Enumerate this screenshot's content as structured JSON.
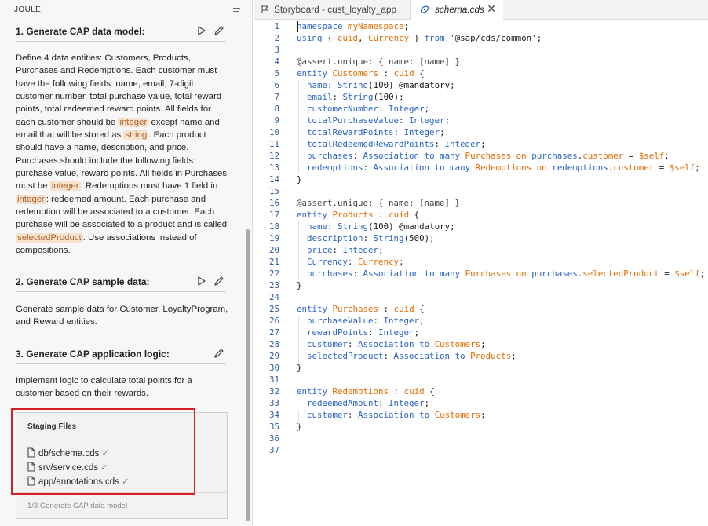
{
  "joule": {
    "header": "JOULE",
    "sections": [
      {
        "title": "1. Generate CAP data model:",
        "body": [
          {
            "t": "Define 4 data entities: Customers, Products, Purchases and Redemptions. Each customer must have the following fields: name, email, 7-digit customer number, total purchase value, total reward points, total redeemed reward points. All fields for each customer should be "
          },
          {
            "tag": "integer"
          },
          {
            "t": " except name and email that will be stored as "
          },
          {
            "tag": "string"
          },
          {
            "t": ". Each product should have a name, description, and price. Purchases should include the following fields: purchase value, reward points. All fields in Purchases must be "
          },
          {
            "tag": "integer"
          },
          {
            "t": ". Redemptions must have 1 field in "
          },
          {
            "tag": "integer"
          },
          {
            "t": ": redeemed amount. Each purchase and redemption will be associated to a customer. Each purchase will be associated to a product and is called "
          },
          {
            "tag": "selectedProduct"
          },
          {
            "t": ". Use associations instead of compositions."
          }
        ]
      },
      {
        "title": "2. Generate CAP sample data:",
        "body": [
          {
            "t": "Generate sample data for Customer, LoyaltyProgram, and Reward entities."
          }
        ]
      },
      {
        "title": "3. Generate CAP application logic:",
        "body": [
          {
            "t": "Implement logic to calculate total points for a customer based on their rewards."
          }
        ]
      }
    ],
    "staging": {
      "title": "Staging Files",
      "files": [
        "db/schema.cds",
        "srv/service.cds",
        "app/annotations.cds"
      ],
      "check": "✓",
      "footer": "1/3 Generate CAP data model"
    }
  },
  "editor": {
    "tabs": [
      {
        "label": "Storyboard - cust_loyalty_app"
      },
      {
        "label": "schema.cds",
        "close": "✕"
      }
    ],
    "lines": [
      [
        [
          "kw",
          "namespace"
        ],
        [
          "pn",
          " "
        ],
        [
          "nm",
          "myNamespace"
        ],
        [
          "pn",
          ";"
        ]
      ],
      [
        [
          "kw",
          "using"
        ],
        [
          "pn",
          " { "
        ],
        [
          "nm",
          "cuid"
        ],
        [
          "pn",
          ", "
        ],
        [
          "nm",
          "Currency"
        ],
        [
          "pn",
          " } "
        ],
        [
          "kw",
          "from"
        ],
        [
          "pn",
          " '"
        ],
        [
          "str",
          "@sap/cds/common"
        ],
        [
          "pn",
          "';"
        ]
      ],
      [],
      [
        [
          "an",
          "@assert.unique: { name: [name] }"
        ]
      ],
      [
        [
          "kw",
          "entity"
        ],
        [
          "pn",
          " "
        ],
        [
          "nm",
          "Customers"
        ],
        [
          "pn",
          " : "
        ],
        [
          "nm",
          "cuid"
        ],
        [
          "pn",
          " {"
        ]
      ],
      [
        [
          "pn",
          "  "
        ],
        [
          "tp",
          "name"
        ],
        [
          "pn",
          ": "
        ],
        [
          "tp",
          "String"
        ],
        [
          "pn",
          "(100) @mandatory;"
        ]
      ],
      [
        [
          "pn",
          "  "
        ],
        [
          "tp",
          "email"
        ],
        [
          "pn",
          ": "
        ],
        [
          "tp",
          "String"
        ],
        [
          "pn",
          "(100);"
        ]
      ],
      [
        [
          "pn",
          "  "
        ],
        [
          "tp",
          "customerNumber"
        ],
        [
          "pn",
          ": "
        ],
        [
          "tp",
          "Integer"
        ],
        [
          "pn",
          ";"
        ]
      ],
      [
        [
          "pn",
          "  "
        ],
        [
          "tp",
          "totalPurchaseValue"
        ],
        [
          "pn",
          ": "
        ],
        [
          "tp",
          "Integer"
        ],
        [
          "pn",
          ";"
        ]
      ],
      [
        [
          "pn",
          "  "
        ],
        [
          "tp",
          "totalRewardPoints"
        ],
        [
          "pn",
          ": "
        ],
        [
          "tp",
          "Integer"
        ],
        [
          "pn",
          ";"
        ]
      ],
      [
        [
          "pn",
          "  "
        ],
        [
          "tp",
          "totalRedeemedRewardPoints"
        ],
        [
          "pn",
          ": "
        ],
        [
          "tp",
          "Integer"
        ],
        [
          "pn",
          ";"
        ]
      ],
      [
        [
          "pn",
          "  "
        ],
        [
          "tp",
          "purchases"
        ],
        [
          "pn",
          ": "
        ],
        [
          "tp",
          "Association"
        ],
        [
          "pn",
          " "
        ],
        [
          "tp",
          "to"
        ],
        [
          "pn",
          " "
        ],
        [
          "tp",
          "many"
        ],
        [
          "pn",
          " "
        ],
        [
          "nm",
          "Purchases"
        ],
        [
          "pn",
          " "
        ],
        [
          "nm",
          "on"
        ],
        [
          "pn",
          " "
        ],
        [
          "tp",
          "purchases"
        ],
        [
          "pn",
          "."
        ],
        [
          "nm",
          "customer"
        ],
        [
          "pn",
          " = "
        ],
        [
          "nm",
          "$self"
        ],
        [
          "pn",
          ";"
        ]
      ],
      [
        [
          "pn",
          "  "
        ],
        [
          "tp",
          "redemptions"
        ],
        [
          "pn",
          ": "
        ],
        [
          "tp",
          "Association"
        ],
        [
          "pn",
          " "
        ],
        [
          "tp",
          "to"
        ],
        [
          "pn",
          " "
        ],
        [
          "tp",
          "many"
        ],
        [
          "pn",
          " "
        ],
        [
          "nm",
          "Redemptions"
        ],
        [
          "pn",
          " "
        ],
        [
          "nm",
          "on"
        ],
        [
          "pn",
          " "
        ],
        [
          "tp",
          "redemptions"
        ],
        [
          "pn",
          "."
        ],
        [
          "nm",
          "customer"
        ],
        [
          "pn",
          " = "
        ],
        [
          "nm",
          "$self"
        ],
        [
          "pn",
          ";"
        ]
      ],
      [
        [
          "pn",
          "}"
        ]
      ],
      [],
      [
        [
          "an",
          "@assert.unique: { name: [name] }"
        ]
      ],
      [
        [
          "kw",
          "entity"
        ],
        [
          "pn",
          " "
        ],
        [
          "nm",
          "Products"
        ],
        [
          "pn",
          " : "
        ],
        [
          "nm",
          "cuid"
        ],
        [
          "pn",
          " {"
        ]
      ],
      [
        [
          "pn",
          "  "
        ],
        [
          "tp",
          "name"
        ],
        [
          "pn",
          ": "
        ],
        [
          "tp",
          "String"
        ],
        [
          "pn",
          "(100) @mandatory;"
        ]
      ],
      [
        [
          "pn",
          "  "
        ],
        [
          "tp",
          "description"
        ],
        [
          "pn",
          ": "
        ],
        [
          "tp",
          "String"
        ],
        [
          "pn",
          "(500);"
        ]
      ],
      [
        [
          "pn",
          "  "
        ],
        [
          "tp",
          "price"
        ],
        [
          "pn",
          ": "
        ],
        [
          "tp",
          "Integer"
        ],
        [
          "pn",
          ";"
        ]
      ],
      [
        [
          "pn",
          "  "
        ],
        [
          "tp",
          "Currency"
        ],
        [
          "pn",
          ": "
        ],
        [
          "nm",
          "Currency"
        ],
        [
          "pn",
          ";"
        ]
      ],
      [
        [
          "pn",
          "  "
        ],
        [
          "tp",
          "purchases"
        ],
        [
          "pn",
          ": "
        ],
        [
          "tp",
          "Association"
        ],
        [
          "pn",
          " "
        ],
        [
          "tp",
          "to"
        ],
        [
          "pn",
          " "
        ],
        [
          "tp",
          "many"
        ],
        [
          "pn",
          " "
        ],
        [
          "nm",
          "Purchases"
        ],
        [
          "pn",
          " "
        ],
        [
          "nm",
          "on"
        ],
        [
          "pn",
          " "
        ],
        [
          "tp",
          "purchases"
        ],
        [
          "pn",
          "."
        ],
        [
          "nm",
          "selectedProduct"
        ],
        [
          "pn",
          " = "
        ],
        [
          "nm",
          "$self"
        ],
        [
          "pn",
          ";"
        ]
      ],
      [
        [
          "pn",
          "}"
        ]
      ],
      [],
      [
        [
          "kw",
          "entity"
        ],
        [
          "pn",
          " "
        ],
        [
          "nm",
          "Purchases"
        ],
        [
          "pn",
          " : "
        ],
        [
          "nm",
          "cuid"
        ],
        [
          "pn",
          " {"
        ]
      ],
      [
        [
          "pn",
          "  "
        ],
        [
          "tp",
          "purchaseValue"
        ],
        [
          "pn",
          ": "
        ],
        [
          "tp",
          "Integer"
        ],
        [
          "pn",
          ";"
        ]
      ],
      [
        [
          "pn",
          "  "
        ],
        [
          "tp",
          "rewardPoints"
        ],
        [
          "pn",
          ": "
        ],
        [
          "tp",
          "Integer"
        ],
        [
          "pn",
          ";"
        ]
      ],
      [
        [
          "pn",
          "  "
        ],
        [
          "tp",
          "customer"
        ],
        [
          "pn",
          ": "
        ],
        [
          "tp",
          "Association"
        ],
        [
          "pn",
          " "
        ],
        [
          "tp",
          "to"
        ],
        [
          "pn",
          " "
        ],
        [
          "nm",
          "Customers"
        ],
        [
          "pn",
          ";"
        ]
      ],
      [
        [
          "pn",
          "  "
        ],
        [
          "tp",
          "selectedProduct"
        ],
        [
          "pn",
          ": "
        ],
        [
          "tp",
          "Association"
        ],
        [
          "pn",
          " "
        ],
        [
          "tp",
          "to"
        ],
        [
          "pn",
          " "
        ],
        [
          "nm",
          "Products"
        ],
        [
          "pn",
          ";"
        ]
      ],
      [
        [
          "pn",
          "}"
        ]
      ],
      [],
      [
        [
          "kw",
          "entity"
        ],
        [
          "pn",
          " "
        ],
        [
          "nm",
          "Redemptions"
        ],
        [
          "pn",
          " : "
        ],
        [
          "nm",
          "cuid"
        ],
        [
          "pn",
          " {"
        ]
      ],
      [
        [
          "pn",
          "  "
        ],
        [
          "tp",
          "redeemedAmount"
        ],
        [
          "pn",
          ": "
        ],
        [
          "tp",
          "Integer"
        ],
        [
          "pn",
          ";"
        ]
      ],
      [
        [
          "pn",
          "  "
        ],
        [
          "tp",
          "customer"
        ],
        [
          "pn",
          ": "
        ],
        [
          "tp",
          "Association"
        ],
        [
          "pn",
          " "
        ],
        [
          "tp",
          "to"
        ],
        [
          "pn",
          " "
        ],
        [
          "nm",
          "Customers"
        ],
        [
          "pn",
          ";"
        ]
      ],
      [
        [
          "pn",
          "}"
        ]
      ],
      [],
      []
    ]
  },
  "colors": {
    "keyword": "#2a64c4",
    "name": "#e36b00",
    "line_number": "#2b5a9e",
    "highlight_bg": "#f6e3cf",
    "highlight_fg": "#b0632c",
    "annotation_box": "#d41f24"
  }
}
